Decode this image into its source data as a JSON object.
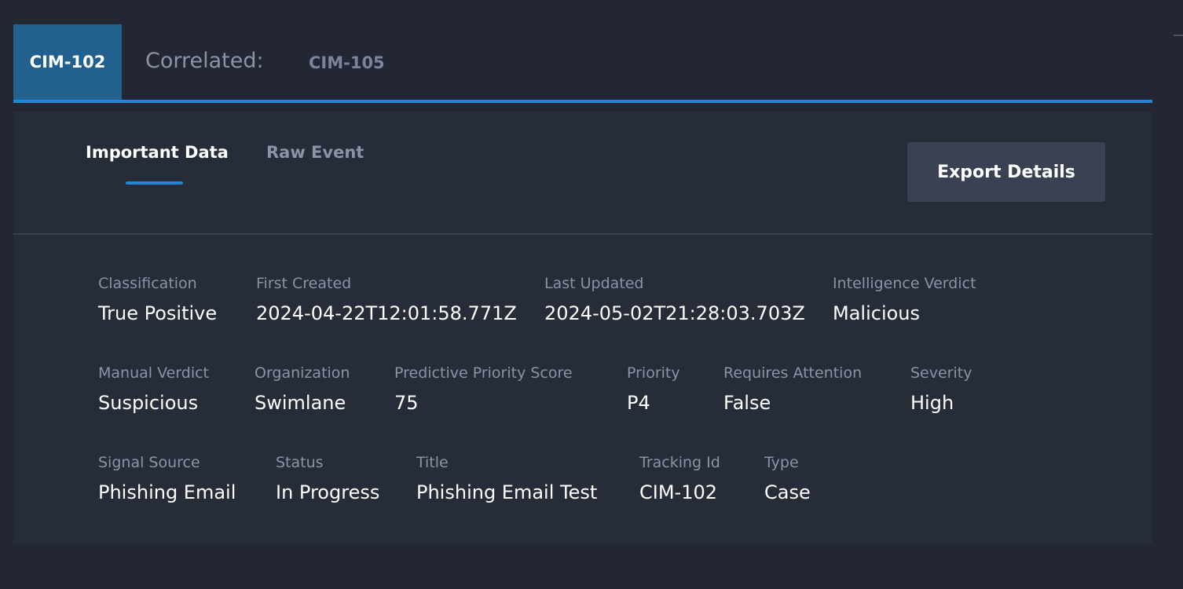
{
  "case_tabs": {
    "active": "CIM-102",
    "correlated_label": "Correlated:",
    "correlated_case": "CIM-105"
  },
  "subtabs": {
    "important": "Important Data",
    "raw": "Raw Event"
  },
  "export_label": "Export Details",
  "fields": {
    "classification": {
      "label": "Classification",
      "value": "True Positive"
    },
    "first_created": {
      "label": "First Created",
      "value": "2024-04-22T12:01:58.771Z"
    },
    "last_updated": {
      "label": "Last Updated",
      "value": "2024-05-02T21:28:03.703Z"
    },
    "intelligence_verdict": {
      "label": "Intelligence Verdict",
      "value": "Malicious"
    },
    "manual_verdict": {
      "label": "Manual Verdict",
      "value": "Suspicious"
    },
    "organization": {
      "label": "Organization",
      "value": "Swimlane"
    },
    "predictive_priority_score": {
      "label": "Predictive Priority Score",
      "value": "75"
    },
    "priority": {
      "label": "Priority",
      "value": "P4"
    },
    "requires_attention": {
      "label": "Requires Attention",
      "value": "False"
    },
    "severity": {
      "label": "Severity",
      "value": "High"
    },
    "signal_source": {
      "label": "Signal Source",
      "value": "Phishing Email"
    },
    "status": {
      "label": "Status",
      "value": "In Progress"
    },
    "title": {
      "label": "Title",
      "value": "Phishing Email Test"
    },
    "tracking_id": {
      "label": "Tracking Id",
      "value": "CIM-102"
    },
    "type": {
      "label": "Type",
      "value": "Case"
    }
  },
  "colors": {
    "background": "#232733",
    "panel": "#272c39",
    "accent": "#1f88d6",
    "active_tab": "#22608e",
    "button": "#3a4152",
    "muted_text": "#8b93a6",
    "text": "#ffffff"
  }
}
